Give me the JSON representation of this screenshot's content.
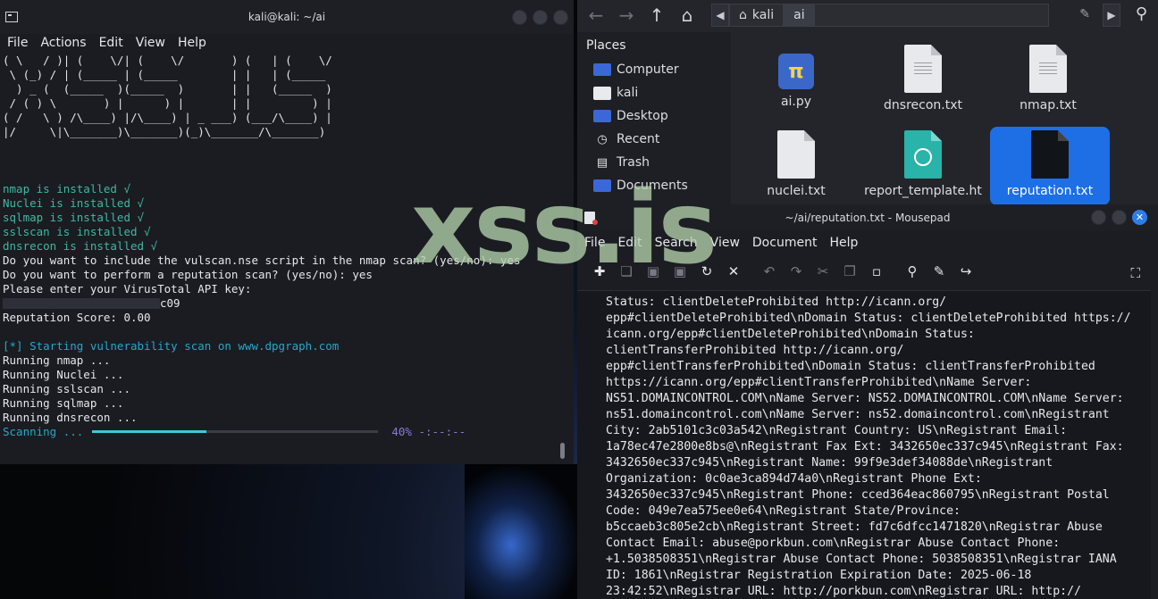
{
  "terminal": {
    "title": "kali@kali: ~/ai",
    "menu": [
      "File",
      "Actions",
      "Edit",
      "View",
      "Help"
    ],
    "ascii_banner": [
      "( \\   / )| (    \\/| (    \\/       ) (   | (    \\/",
      " \\ (_) / | (_____ | (_____        | |   | (_____ ",
      "  ) _ (  (_____  )(_____  )       | |   (_____  )",
      " / ( ) \\       ) |      ) |       | |         ) |",
      "( /   \\ ) /\\____) |/\\____) | _ ___) (___/\\____) |",
      "|/     \\|\\_______)\\_______)(_)\\_______/\\_______)"
    ],
    "installed": [
      "nmap is installed √",
      "Nuclei is installed √",
      "sqlmap is installed √",
      "sslscan is installed √",
      "dnsrecon is installed √"
    ],
    "prompt_vulscan": "Do you want to include the vulscan.nse script in the nmap scan? (yes/no): yes",
    "prompt_reputation": "Do you want to perform a reputation scan? (yes/no): yes",
    "prompt_api_key": "Please enter your VirusTotal API key:",
    "api_key_tail": "c09",
    "reputation_score": "Reputation Score: 0.00",
    "scan_start": "[*] Starting vulnerability scan on www.dpgraph.com",
    "running": [
      "Running nmap ...",
      "Running Nuclei ...",
      "Running sslscan ...",
      "Running sqlmap ...",
      "Running dnsrecon ..."
    ],
    "scanning_label": "Scanning ...",
    "progress_fraction": 0.4,
    "progress_text": "40% -:--:--"
  },
  "file_manager": {
    "path": [
      "kali",
      "ai"
    ],
    "places_title": "Places",
    "places": [
      "Computer",
      "kali",
      "Desktop",
      "Recent",
      "Trash",
      "Documents"
    ],
    "files": [
      {
        "name": "ai.py",
        "kind": "python"
      },
      {
        "name": "dnsrecon.txt",
        "kind": "text"
      },
      {
        "name": "nmap.txt",
        "kind": "text"
      },
      {
        "name": "nuclei.txt",
        "kind": "blank"
      },
      {
        "name": "report_template.ht",
        "kind": "html"
      },
      {
        "name": "reputation.txt",
        "kind": "text-dark",
        "selected": true
      }
    ]
  },
  "mousepad": {
    "title": "~/ai/reputation.txt - Mousepad",
    "menu": [
      "File",
      "Edit",
      "Search",
      "View",
      "Document",
      "Help"
    ],
    "lines": [
      "Status: clientDeleteProhibited http://icann.org/",
      "epp#clientDeleteProhibited\\nDomain Status: clientDeleteProhibited https://",
      "icann.org/epp#clientDeleteProhibited\\nDomain Status:",
      "clientTransferProhibited http://icann.org/",
      "epp#clientTransferProhibited\\nDomain Status: clientTransferProhibited",
      "https://icann.org/epp#clientTransferProhibited\\nName Server:",
      "NS51.DOMAINCONTROL.COM\\nName Server: NS52.DOMAINCONTROL.COM\\nName Server:",
      "ns51.domaincontrol.com\\nName Server: ns52.domaincontrol.com\\nRegistrant",
      "City: 2ab5101c3c03a542\\nRegistrant Country: US\\nRegistrant Email:",
      "1a78ec47e2800e8bs@\\nRegistrant Fax Ext: 3432650ec337c945\\nRegistrant Fax:",
      "3432650ec337c945\\nRegistrant Name: 99f9e3def34088de\\nRegistrant",
      "Organization: 0c0ae3ca894d74a0\\nRegistrant Phone Ext:",
      "3432650ec337c945\\nRegistrant Phone: cced364eac860795\\nRegistrant Postal",
      "Code: 049e7ea575ee0e64\\nRegistrant State/Province:",
      "b5ccaeb3c805e2cb\\nRegistrant Street: fd7c6dfcc1471820\\nRegistrar Abuse",
      "Contact Email: abuse@porkbun.com\\nRegistrar Abuse Contact Phone:",
      "+1.5038508351\\nRegistrar Abuse Contact Phone: 5038508351\\nRegistrar IANA",
      "ID: 1861\\nRegistrar Registration Expiration Date: 2025-06-18",
      "23:42:52\\nRegistrar URL: http://porkbun.com\\nRegistrar URL: http://"
    ]
  },
  "watermark": "xss.is"
}
